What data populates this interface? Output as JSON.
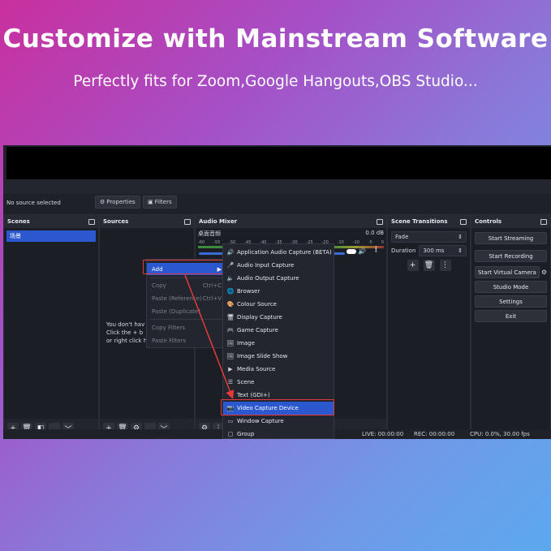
{
  "hero": {
    "title": "Customize with Mainstream Software",
    "subtitle": "Perfectly fits for Zoom,Google Hangouts,OBS Studio..."
  },
  "obs": {
    "no_source": "No source selected",
    "properties_label": "Properties",
    "filters_label": "Filters",
    "scenes": {
      "title": "Scenes",
      "items": [
        "场景"
      ]
    },
    "sources": {
      "title": "Sources",
      "hint_lines": [
        "You don't hav",
        "Click the + b",
        "or right click h"
      ]
    },
    "mixer": {
      "title": "Audio Mixer",
      "channel": "桌面音频",
      "level": "0.0 dB",
      "scale": [
        "-60",
        "-55",
        "-50",
        "-45",
        "-40",
        "-35",
        "-30",
        "-25",
        "-20",
        "-15",
        "-10",
        "-5",
        "0"
      ]
    },
    "transitions": {
      "title": "Scene Transitions",
      "transition": "Fade",
      "duration_label": "Duration",
      "duration_value": "300 ms"
    },
    "controls": {
      "title": "Controls",
      "buttons": [
        "Start Streaming",
        "Start Recording",
        "Start Virtual Camera",
        "Studio Mode",
        "Settings",
        "Exit"
      ]
    },
    "context_menu": {
      "add": "Add",
      "copy": "Copy",
      "copy_shortcut": "Ctrl+C",
      "paste_ref": "Paste (Reference)",
      "paste_ref_shortcut": "Ctrl+V",
      "paste_dup": "Paste (Duplicate)",
      "copy_filters": "Copy Filters",
      "paste_filters": "Paste Filters"
    },
    "add_menu": [
      "Application Audio Capture (BETA)",
      "Audio Input Capture",
      "Audio Output Capture",
      "Browser",
      "Colour Source",
      "Display Capture",
      "Game Capture",
      "Image",
      "Image Slide Show",
      "Media Source",
      "Scene",
      "Text (GDI+)",
      "Video Capture Device",
      "Window Capture",
      "Group"
    ],
    "status": {
      "live": "LIVE: 00:00:00",
      "rec": "REC: 00:00:00",
      "cpu": "CPU: 0.0%, 30.00 fps"
    },
    "colors": {
      "accent": "#2b58cf",
      "highlight": "#e43a3a"
    }
  }
}
